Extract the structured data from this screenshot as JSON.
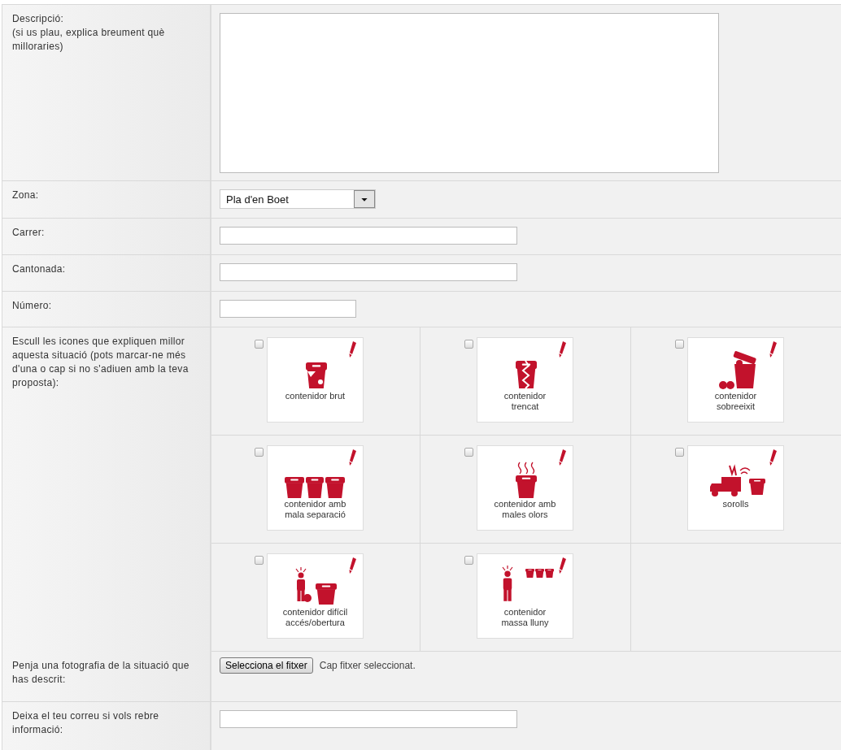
{
  "fields": [
    {
      "kind": "textarea",
      "label": "Descripció:",
      "note": "(si us plau, explica breument què milloraries)"
    },
    {
      "kind": "select",
      "label": "Zona:",
      "value": "Pla d'en Boet"
    },
    {
      "kind": "text",
      "label": "Carrer:"
    },
    {
      "kind": "text",
      "label": "Cantonada:"
    },
    {
      "kind": "number",
      "label": "Número:"
    },
    {
      "kind": "icons",
      "label": "Escull les icones que expliquen millor aquesta situació (pots marcar-ne més d'una o cap si no s'adiuen amb la teva proposta):",
      "options": [
        {
          "kind": "dirty",
          "caption": [
            "contenidor brut"
          ],
          "checked": false
        },
        {
          "kind": "broken",
          "caption": [
            "contenidor",
            "trencat"
          ],
          "checked": false
        },
        {
          "kind": "overflow",
          "caption": [
            "contenidor",
            "sobreeixit"
          ],
          "checked": false
        },
        {
          "kind": "mixed",
          "caption": [
            "contenidor amb",
            "mala separació"
          ],
          "checked": false
        },
        {
          "kind": "smell",
          "caption": [
            "contenidor amb",
            "males olors"
          ],
          "checked": false
        },
        {
          "kind": "noise",
          "caption": [
            "sorolls"
          ],
          "checked": false
        },
        {
          "kind": "access",
          "caption": [
            "contenidor difícil",
            "accés/obertura"
          ],
          "checked": false
        },
        {
          "kind": "far",
          "caption": [
            "contenidor",
            "massa lluny"
          ],
          "checked": false
        }
      ]
    },
    {
      "kind": "file",
      "label": "Penja una fotografia de la situació que has descrit:",
      "button": "Selecciona el fitxer",
      "status": "Cap fitxer seleccionat."
    },
    {
      "kind": "text",
      "label": "Deixa el teu correu si vols rebre informació:"
    }
  ]
}
